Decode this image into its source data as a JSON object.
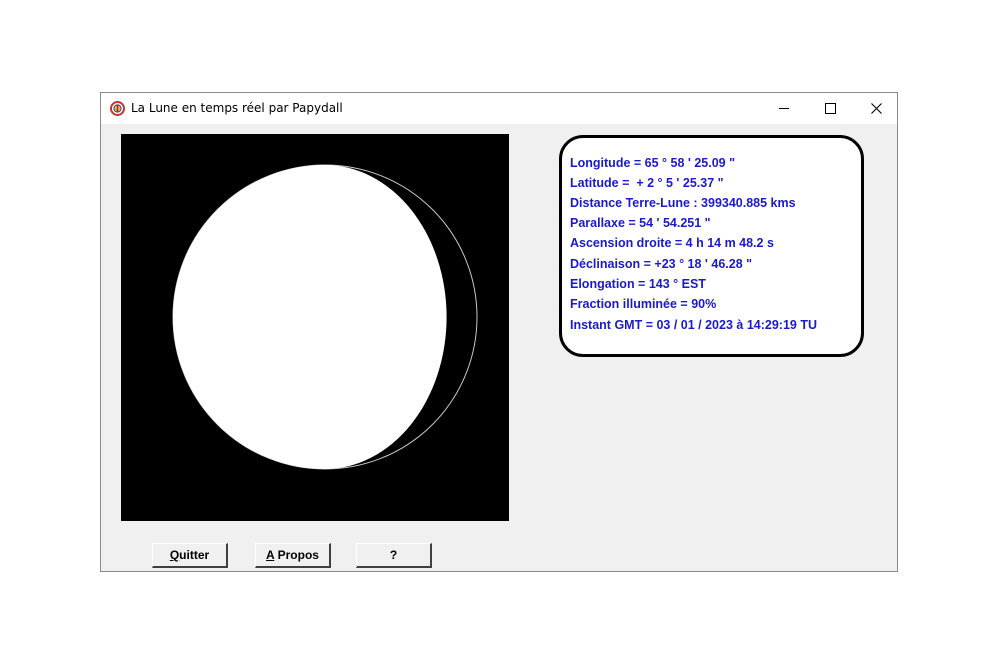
{
  "window": {
    "title": "La Lune en temps réel par Papydall"
  },
  "moon": {
    "illuminated_fraction": 0.9
  },
  "info": {
    "lines": [
      "Longitude = 65 ° 58 ' 25.09 \"",
      "Latitude =  + 2 ° 5 ' 25.37 \"",
      "Distance Terre-Lune : 399340.885 kms",
      "Parallaxe = 54 ' 54.251 \"",
      "Ascension droite = 4 h 14 m 48.2 s",
      "Déclinaison = +23 ° 18 ' 46.28 \"",
      "Elongation = 143 ° EST",
      "Fraction illuminée = 90%",
      "Instant GMT = 03 / 01 / 2023 à 14:29:19 TU"
    ],
    "text_color": "#1a1acc"
  },
  "buttons": {
    "quit_mnemonic": "Q",
    "quit_rest": "uitter",
    "about_mnemonic": "A",
    "about_rest": " Propos",
    "help_label": "?"
  }
}
